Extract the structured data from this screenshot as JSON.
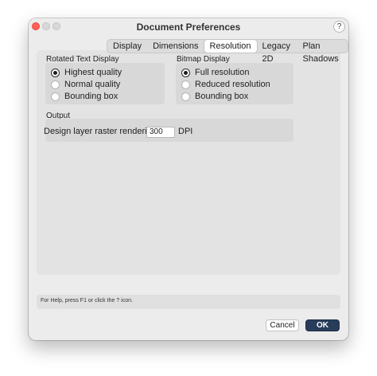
{
  "window": {
    "title": "Document Preferences",
    "help_button": "?"
  },
  "tabs": [
    {
      "label": "Display",
      "active": false
    },
    {
      "label": "Dimensions",
      "active": false
    },
    {
      "label": "Resolution",
      "active": true
    },
    {
      "label": "Legacy 2D",
      "active": false
    },
    {
      "label": "Plan Shadows",
      "active": false
    }
  ],
  "rotated_text": {
    "title": "Rotated Text Display",
    "options": [
      {
        "label": "Highest quality",
        "checked": true
      },
      {
        "label": "Normal quality",
        "checked": false
      },
      {
        "label": "Bounding box",
        "checked": false
      }
    ]
  },
  "bitmap": {
    "title": "Bitmap Display",
    "options": [
      {
        "label": "Full resolution",
        "checked": true
      },
      {
        "label": "Reduced resolution",
        "checked": false
      },
      {
        "label": "Bounding box",
        "checked": false
      }
    ]
  },
  "output": {
    "title": "Output",
    "raster_label": "Design layer raster rendering:",
    "raster_value": "300",
    "unit": "DPI"
  },
  "help_text": "For Help, press F1 or click the ? icon.",
  "buttons": {
    "cancel": "Cancel",
    "ok": "OK"
  }
}
